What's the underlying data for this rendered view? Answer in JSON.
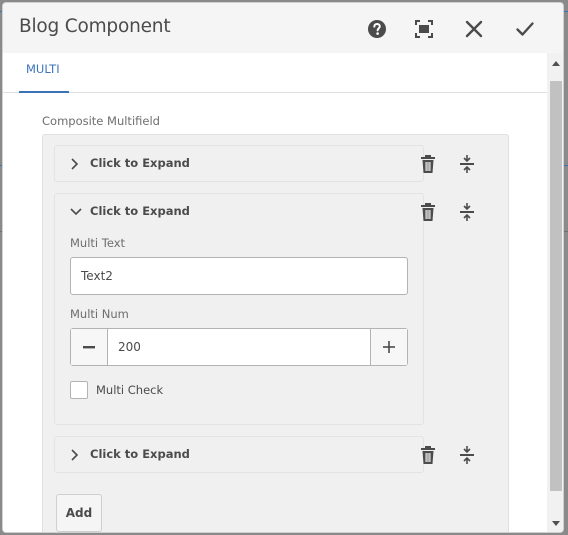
{
  "dialog": {
    "title": "Blog Component",
    "header_icons": [
      "help-icon",
      "fullscreen-icon",
      "close-icon",
      "done-icon"
    ]
  },
  "tabs": [
    {
      "label": "MULTI",
      "active": true
    }
  ],
  "multifield": {
    "label": "Composite Multifield",
    "items": [
      {
        "title": "Click to Expand",
        "expanded": false
      },
      {
        "title": "Click to Expand",
        "expanded": true,
        "multi_text_label": "Multi Text",
        "multi_text_value": "Text2",
        "multi_num_label": "Multi Num",
        "multi_num_value": "200",
        "multi_check_label": "Multi Check",
        "multi_check_checked": false
      },
      {
        "title": "Click to Expand",
        "expanded": false
      }
    ],
    "add_label": "Add"
  },
  "colors": {
    "accent": "#3b73b9",
    "text": "#4b4b4b",
    "panel": "#f0f0f0"
  }
}
